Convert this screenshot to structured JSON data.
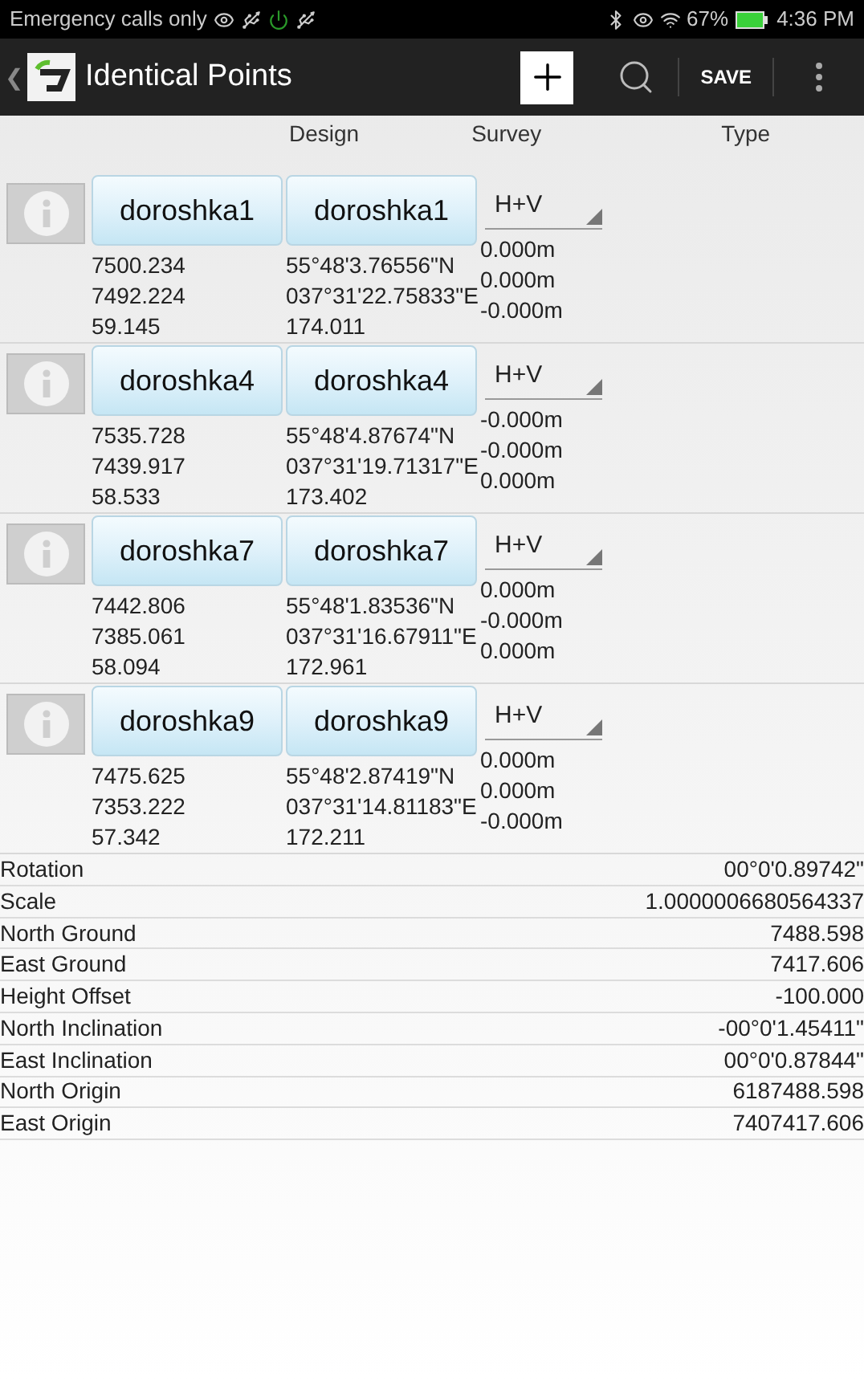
{
  "status_bar": {
    "carrier": "Emergency calls only",
    "battery": "67%",
    "time": "4:36 PM"
  },
  "app_bar": {
    "back": "❮",
    "title": "Identical Points",
    "save": "SAVE"
  },
  "columns": [
    "Design",
    "Survey",
    "Type"
  ],
  "points": [
    {
      "design": "doroshka1",
      "survey": "doroshka1",
      "type": "H+V",
      "local": [
        "7500.234",
        "7492.224",
        "59.145"
      ],
      "geo": [
        "55°48'3.76556\"N",
        "037°31'22.75833\"E",
        "174.011"
      ],
      "residuals": [
        "0.000m",
        "0.000m",
        "-0.000m"
      ]
    },
    {
      "design": "doroshka4",
      "survey": "doroshka4",
      "type": "H+V",
      "local": [
        "7535.728",
        "7439.917",
        "58.533"
      ],
      "geo": [
        "55°48'4.87674\"N",
        "037°31'19.71317\"E",
        "173.402"
      ],
      "residuals": [
        "-0.000m",
        "-0.000m",
        "0.000m"
      ]
    },
    {
      "design": "doroshka7",
      "survey": "doroshka7",
      "type": "H+V",
      "local": [
        "7442.806",
        "7385.061",
        "58.094"
      ],
      "geo": [
        "55°48'1.83536\"N",
        "037°31'16.67911\"E",
        "172.961"
      ],
      "residuals": [
        "0.000m",
        "-0.000m",
        "0.000m"
      ]
    },
    {
      "design": "doroshka9",
      "survey": "doroshka9",
      "type": "H+V",
      "local": [
        "7475.625",
        "7353.222",
        "57.342"
      ],
      "geo": [
        "55°48'2.87419\"N",
        "037°31'14.81183\"E",
        "172.211"
      ],
      "residuals": [
        "0.000m",
        "0.000m",
        "-0.000m"
      ]
    }
  ],
  "results": [
    {
      "label": "Rotation",
      "value": "00°0'0.89742\""
    },
    {
      "label": "Scale",
      "value": "1.0000006680564337"
    },
    {
      "label": "North Ground",
      "value": "7488.598"
    },
    {
      "label": "East Ground",
      "value": "7417.606"
    },
    {
      "label": "Height Offset",
      "value": "-100.000"
    },
    {
      "label": "North Inclination",
      "value": "-00°0'1.45411\""
    },
    {
      "label": "East Inclination",
      "value": "00°0'0.87844\""
    },
    {
      "label": "North Origin",
      "value": "6187488.598"
    },
    {
      "label": "East Origin",
      "value": "7407417.606"
    }
  ]
}
